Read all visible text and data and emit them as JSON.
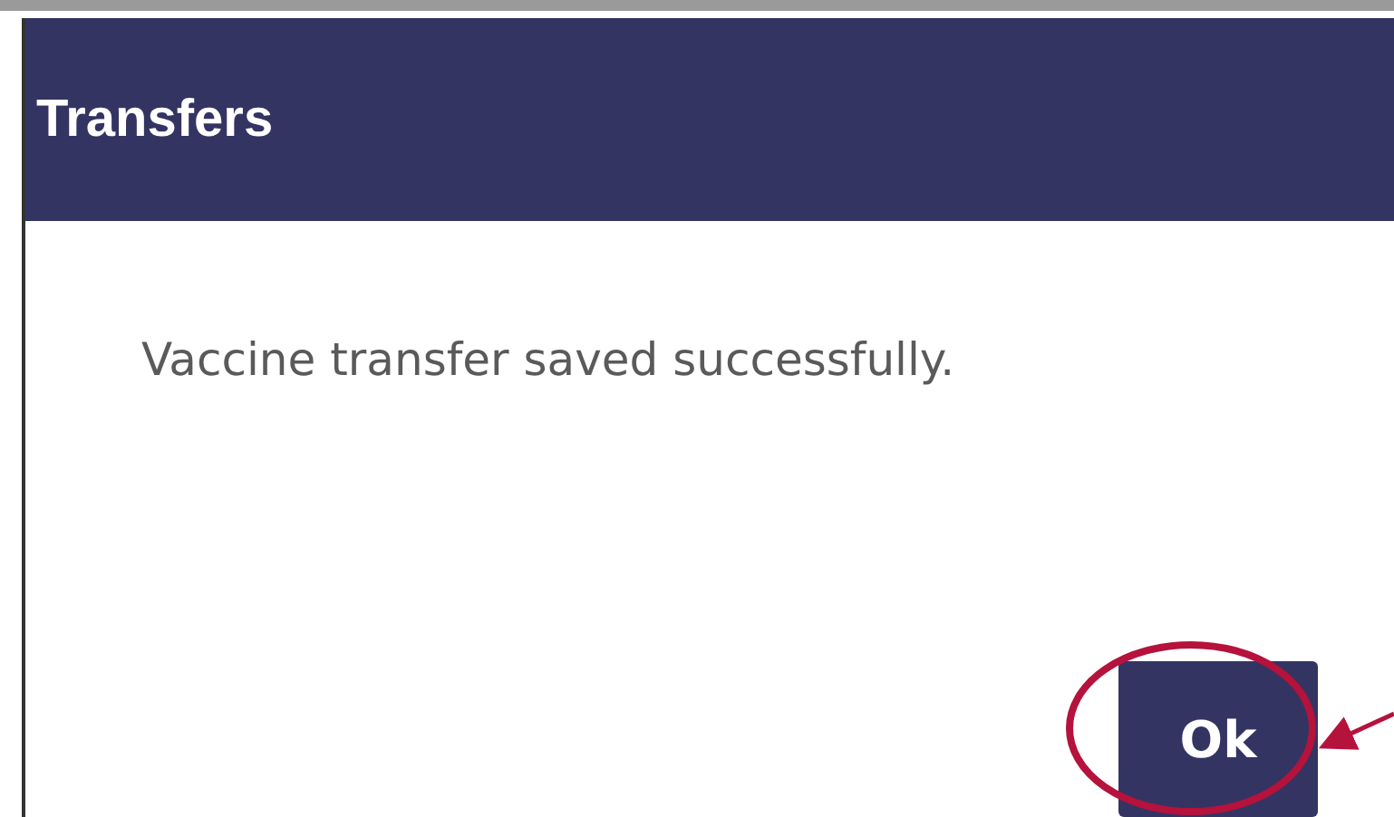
{
  "dialog": {
    "title": "Transfers",
    "message": "Vaccine transfer saved successfully.",
    "buttons": [
      {
        "label": "Ok"
      }
    ]
  }
}
